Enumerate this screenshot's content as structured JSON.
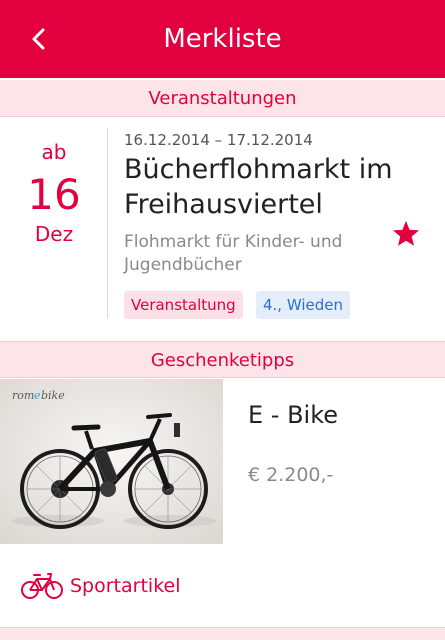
{
  "appbar": {
    "title": "Merkliste",
    "back_icon": "back-chevron-icon"
  },
  "colors": {
    "accent": "#e2003f",
    "section_bg": "#fde4e9",
    "district_tag_text": "#2b6fd6",
    "district_tag_bg": "#e4eefb"
  },
  "sections": {
    "events_header": "Veranstaltungen",
    "gifts_header": "Geschenketipps"
  },
  "event": {
    "date_prefix": "ab",
    "day": "16",
    "month": "Dez",
    "date_range": "16.12.2014 – 17.12.2014",
    "title": "Bücherflohmarkt im Freihausviertel",
    "description": "Flohmarkt für Kinder- und Jugendbücher",
    "favorite_icon": "star-icon",
    "tags": [
      "Veranstaltung",
      "4., Wieden"
    ]
  },
  "gift": {
    "title": "E - Bike",
    "price": "€ 2.200,-",
    "image_logo_text": "romebike",
    "category_icon": "bicycle-icon",
    "category_label": "Sportartikel"
  }
}
